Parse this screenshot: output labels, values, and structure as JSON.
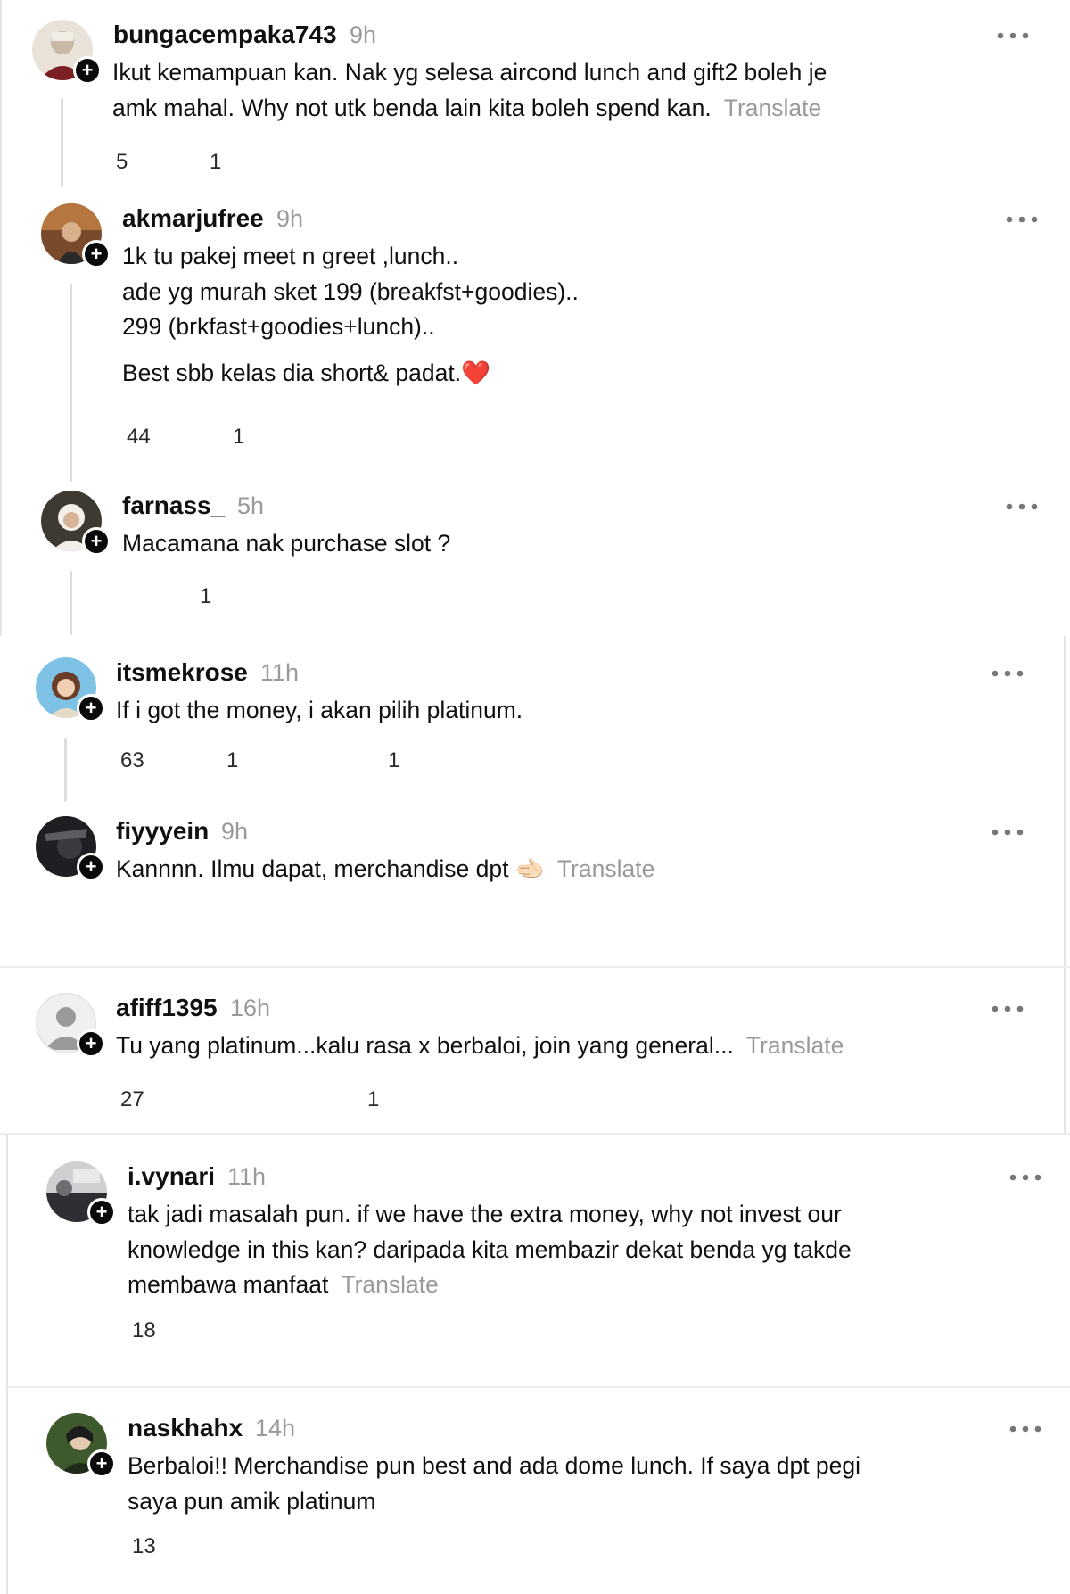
{
  "translate_label": "Translate",
  "comments": [
    {
      "username": "bungacempaka743",
      "time": "9h",
      "lines": [
        "Ikut kemampuan kan. Nak yg selesa aircond lunch and gift2 boleh je",
        "amk mahal. Why not utk benda lain kita boleh spend kan."
      ],
      "translate": true,
      "likes": "5",
      "replies": "1",
      "shares": ""
    },
    {
      "username": "akmarjufree",
      "time": "9h",
      "lines": [
        "1k tu pakej meet n greet ,lunch..",
        "ade yg murah sket 199 (breakfst+goodies)..",
        "299 (brkfast+goodies+lunch)..",
        "Best sbb kelas dia short& padat.❤️"
      ],
      "translate": false,
      "likes": "44",
      "replies": "1",
      "shares": ""
    },
    {
      "username": "farnass_",
      "time": "5h",
      "lines": [
        "Macamana nak purchase slot ?"
      ],
      "translate": false,
      "likes": "",
      "replies": "1",
      "shares": ""
    },
    {
      "username": "itsmekrose",
      "time": "11h",
      "lines": [
        "If i got the money, i akan pilih platinum."
      ],
      "translate": false,
      "likes": "63",
      "replies": "1",
      "shares": "1"
    },
    {
      "username": "fiyyyein",
      "time": "9h",
      "lines": [
        "Kannnn. Ilmu dapat, merchandise dpt 🫲🏻"
      ],
      "translate": true,
      "likes": "",
      "replies": "",
      "shares": ""
    },
    {
      "username": "afiff1395",
      "time": "16h",
      "lines": [
        "Tu yang platinum...kalu rasa x berbaloi, join yang general..."
      ],
      "translate": true,
      "likes": "27",
      "replies": "",
      "shares": "1"
    },
    {
      "username": "i.vynari",
      "time": "11h",
      "lines": [
        "tak jadi masalah pun. if we have the extra money, why not invest our",
        "knowledge in this kan? daripada kita membazir dekat benda yg takde",
        "membawa manfaat"
      ],
      "translate": true,
      "likes": "18",
      "replies": "",
      "shares": ""
    },
    {
      "username": "naskhahx",
      "time": "14h",
      "lines": [
        "Berbaloi!! Merchandise pun best and ada dome lunch. If saya dpt pegi",
        "saya pun amik platinum"
      ],
      "translate": false,
      "likes": "13",
      "replies": "",
      "shares": ""
    }
  ]
}
